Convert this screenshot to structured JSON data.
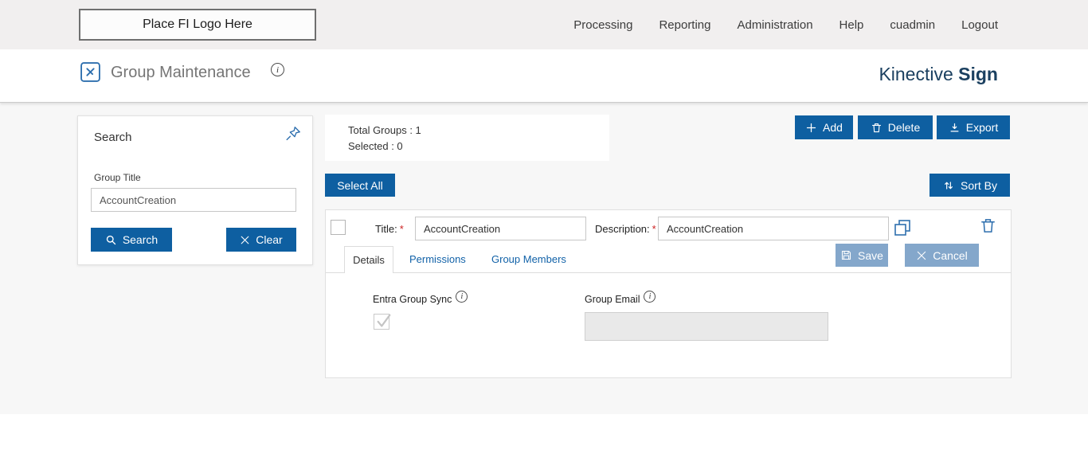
{
  "header": {
    "logo_text": "Place FI Logo Here",
    "nav": [
      {
        "label": "Processing"
      },
      {
        "label": "Reporting"
      },
      {
        "label": "Administration"
      },
      {
        "label": "Help"
      },
      {
        "label": "cuadmin"
      },
      {
        "label": "Logout"
      }
    ]
  },
  "subheader": {
    "title": "Group Maintenance",
    "brand_first": "Kinective",
    "brand_second": "Sign"
  },
  "search_panel": {
    "title": "Search",
    "group_title_label": "Group Title",
    "group_title_value": "AccountCreation",
    "search_button_label": "Search",
    "clear_button_label": "Clear"
  },
  "summary": {
    "total_groups": "Total Groups : 1",
    "selected": "Selected : 0"
  },
  "toolbar": {
    "add_label": "Add",
    "delete_label": "Delete",
    "export_label": "Export",
    "select_all_label": "Select All",
    "sort_by_label": "Sort By"
  },
  "group_row": {
    "title_label": "Title:",
    "required_mark": "*",
    "title_value": "AccountCreation",
    "description_label": "Description:",
    "description_value": "AccountCreation",
    "tabs": [
      {
        "label": "Details"
      },
      {
        "label": "Permissions"
      },
      {
        "label": "Group Members"
      }
    ],
    "save_label": "Save",
    "cancel_label": "Cancel",
    "details_tab": {
      "entra_group_sync_label": "Entra Group Sync",
      "entra_checked": true,
      "group_email_label": "Group Email",
      "group_email_value": ""
    }
  },
  "colors": {
    "primary_blue": "#0e5fa1",
    "link_blue": "#1262a8",
    "brand_navy": "#1b4060",
    "save_cancel_blue": "#84a7cb",
    "required_red": "#cc2222",
    "topbar_gray": "#f1efef",
    "content_gray": "#f7f7f7"
  },
  "icons": {
    "group-maintenance-icon": "signature-page",
    "info-icon": "i-in-circle",
    "pin-icon": "pushpin",
    "search-icon": "magnifier",
    "clear-icon": "x",
    "add-icon": "plus",
    "delete-icon": "trash",
    "export-icon": "download-arrow",
    "sort-by-icon": "up-down-arrows",
    "copy-icon": "overlapping-squares",
    "row-delete-icon": "trash",
    "save-icon": "floppy-disk",
    "cancel-icon": "x",
    "entra-check-icon": "checkmark"
  }
}
